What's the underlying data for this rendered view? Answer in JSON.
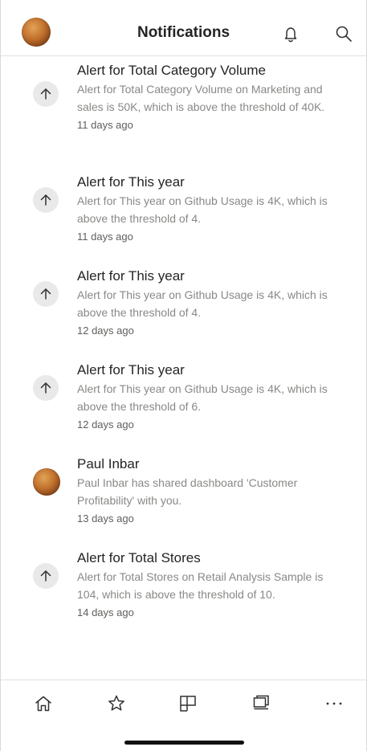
{
  "header": {
    "title": "Notifications"
  },
  "notifications": [
    {
      "title": "Alert for Total Category Volume",
      "body": "Alert for Total Category Volume on Marketing and sales is 50K, which is above the threshold of 40K.",
      "time": "11 days ago",
      "icon": "arrow-up-icon"
    },
    {
      "title": "Alert for This year",
      "body": "Alert for This year on Github Usage is 4K, which is above the threshold of 4.",
      "time": "11 days ago",
      "icon": "arrow-up-icon"
    },
    {
      "title": "Alert for This year",
      "body": "Alert for This year on Github Usage is 4K, which is above the threshold of 4.",
      "time": "12 days ago",
      "icon": "arrow-up-icon"
    },
    {
      "title": "Alert for This year",
      "body": "Alert for This year on Github Usage is 4K, which is above the threshold of 6.",
      "time": "12 days ago",
      "icon": "arrow-up-icon"
    },
    {
      "title": "Paul Inbar",
      "body": "Paul Inbar has shared dashboard 'Customer Profitability' with you.",
      "time": "13 days ago",
      "icon": "avatar"
    },
    {
      "title": "Alert for Total Stores",
      "body": "Alert for Total Stores on Retail Analysis Sample is 104, which is above the threshold of 10.",
      "time": "14 days ago",
      "icon": "arrow-up-icon"
    }
  ],
  "icons": {
    "header": [
      "avatar",
      "bell-icon",
      "search-icon"
    ],
    "bottom_nav": [
      "home-icon",
      "star-icon",
      "apps-icon",
      "workspaces-icon",
      "more-icon"
    ]
  },
  "colors": {
    "title_text": "#252423",
    "body_text": "#8a8886",
    "time_text": "#605e5c",
    "icon_circle": "#e9e9e9"
  }
}
